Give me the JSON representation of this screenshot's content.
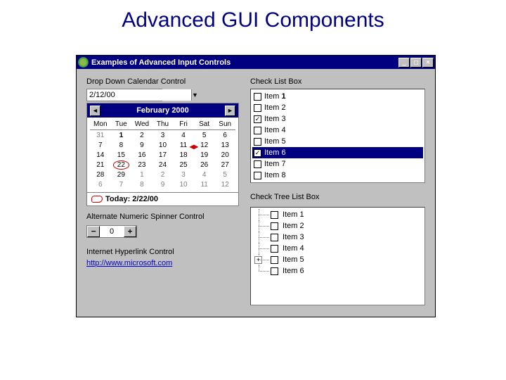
{
  "slide_title": "Advanced GUI Components",
  "window": {
    "title": "Examples of Advanced Input Controls",
    "min_label": "_",
    "max_label": "□",
    "close_label": "×"
  },
  "dropdown": {
    "label": "Drop Down Calendar Control",
    "value": "2/12/00",
    "arrow": "▼"
  },
  "calendar": {
    "prev": "◄",
    "next": "►",
    "month_year": "February 2000",
    "dow": [
      "Mon",
      "Tue",
      "Wed",
      "Thu",
      "Fri",
      "Sat",
      "Sun"
    ],
    "days": [
      {
        "n": "31",
        "o": true
      },
      {
        "n": "1",
        "b": true
      },
      {
        "n": "2"
      },
      {
        "n": "3"
      },
      {
        "n": "4"
      },
      {
        "n": "5"
      },
      {
        "n": "6"
      },
      {
        "n": "7"
      },
      {
        "n": "8"
      },
      {
        "n": "9"
      },
      {
        "n": "10"
      },
      {
        "n": "11"
      },
      {
        "n": "12",
        "mark": true
      },
      {
        "n": "13"
      },
      {
        "n": "14"
      },
      {
        "n": "15"
      },
      {
        "n": "16"
      },
      {
        "n": "17"
      },
      {
        "n": "18"
      },
      {
        "n": "19"
      },
      {
        "n": "20"
      },
      {
        "n": "21"
      },
      {
        "n": "22",
        "circled": true
      },
      {
        "n": "23"
      },
      {
        "n": "24"
      },
      {
        "n": "25"
      },
      {
        "n": "26"
      },
      {
        "n": "27"
      },
      {
        "n": "28"
      },
      {
        "n": "29"
      },
      {
        "n": "1",
        "o": true
      },
      {
        "n": "2",
        "o": true
      },
      {
        "n": "3",
        "o": true
      },
      {
        "n": "4",
        "o": true
      },
      {
        "n": "5",
        "o": true
      },
      {
        "n": "6",
        "o": true
      },
      {
        "n": "7",
        "o": true
      },
      {
        "n": "8",
        "o": true
      },
      {
        "n": "9",
        "o": true
      },
      {
        "n": "10",
        "o": true
      },
      {
        "n": "11",
        "o": true
      },
      {
        "n": "12",
        "o": true
      }
    ],
    "footer_label": "Today: 2/22/00"
  },
  "spinner": {
    "label": "Alternate Numeric Spinner Control",
    "minus": "−",
    "value": "0",
    "plus": "+"
  },
  "hyperlink": {
    "label": "Internet Hyperlink Control",
    "url": "http://www.microsoft.com"
  },
  "checklist": {
    "label": "Check List Box",
    "items": [
      {
        "text": "Item 1",
        "bold_suffix": "1",
        "prefix": "Item ",
        "checked": false
      },
      {
        "text": "Item 2",
        "checked": false
      },
      {
        "text": "Item 3",
        "checked": true
      },
      {
        "text": "Item 4",
        "checked": false
      },
      {
        "text": "Item 5",
        "checked": false
      },
      {
        "text": "Item 6",
        "checked": true,
        "selected": true
      },
      {
        "text": "Item 7",
        "checked": false
      },
      {
        "text": "Item 8",
        "checked": false
      }
    ]
  },
  "tree": {
    "label": "Check Tree List Box",
    "items": [
      {
        "text": "Item 1"
      },
      {
        "text": "Item 2"
      },
      {
        "text": "Item 3"
      },
      {
        "text": "Item 4"
      },
      {
        "text": "Item 5",
        "expandable": true,
        "glyph": "+"
      },
      {
        "text": "Item 6",
        "last": true
      }
    ]
  }
}
